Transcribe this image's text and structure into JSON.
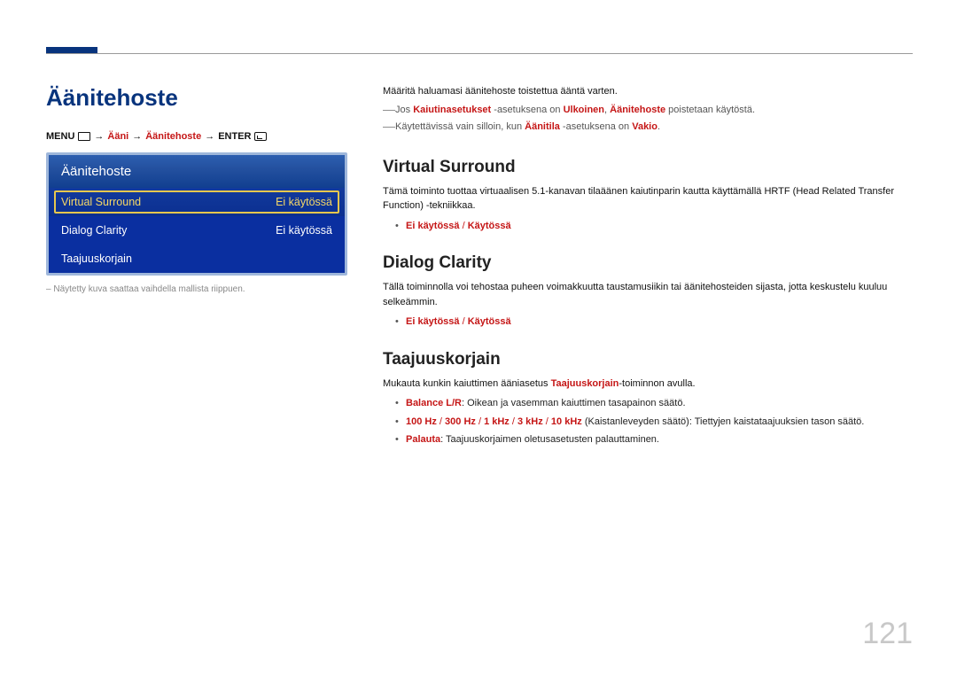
{
  "page_number": "121",
  "title": "Äänitehoste",
  "breadcrumb": {
    "menu": "MENU",
    "arrow": "→",
    "p1": "Ääni",
    "p2": "Äänitehoste",
    "enter": "ENTER"
  },
  "panel": {
    "header": "Äänitehoste",
    "rows": [
      {
        "label": "Virtual Surround",
        "value": "Ei käytössä",
        "selected": true
      },
      {
        "label": "Dialog Clarity",
        "value": "Ei käytössä",
        "selected": false
      },
      {
        "label": "Taajuuskorjain",
        "value": "",
        "selected": false
      }
    ]
  },
  "panel_caption": "Näytetty kuva saattaa vaihdella mallista riippuen.",
  "intro": {
    "line": "Määritä haluamasi äänitehoste toistettua ääntä varten.",
    "note1_pre": "Jos ",
    "note1_b1": "Kaiutinasetukset",
    "note1_mid": " -asetuksena on ",
    "note1_b2": "Ulkoinen",
    "note1_sep": ", ",
    "note1_b3": "Äänitehoste",
    "note1_post": " poistetaan käytöstä.",
    "note2_pre": "Käytettävissä vain silloin, kun ",
    "note2_b1": "Äänitila",
    "note2_mid": " -asetuksena on ",
    "note2_b2": "Vakio",
    "note2_post": "."
  },
  "sections": {
    "virtual": {
      "heading": "Virtual Surround",
      "desc": "Tämä toiminto tuottaa virtuaalisen 5.1-kanavan tilaäänen kaiutinparin kautta käyttämällä HRTF (Head Related Transfer Function) -tekniikkaa.",
      "opt1": "Ei käytössä",
      "opt_sep": " / ",
      "opt2": "Käytössä"
    },
    "dialog": {
      "heading": "Dialog Clarity",
      "desc": "Tällä toiminnolla voi tehostaa puheen voimakkuutta taustamusiikin tai äänitehosteiden sijasta, jotta keskustelu kuuluu selkeämmin.",
      "opt1": "Ei käytössä",
      "opt_sep": " / ",
      "opt2": "Käytössä"
    },
    "eq": {
      "heading": "Taajuuskorjain",
      "desc_pre": "Mukauta kunkin kaiuttimen ääniasetus ",
      "desc_b": "Taajuuskorjain",
      "desc_post": "-toiminnon avulla.",
      "b1_label": "Balance L/R",
      "b1_rest": ": Oikean ja vasemman kaiuttimen tasapainon säätö.",
      "b2_f1": "100 Hz",
      "b2_f2": "300 Hz",
      "b2_f3": "1 kHz",
      "b2_f4": "3 kHz",
      "b2_f5": "10 kHz",
      "b2_rest": " (Kaistanleveyden säätö): Tiettyjen kaistataajuuksien tason säätö.",
      "b3_label": "Palauta",
      "b3_rest": ": Taajuuskorjaimen oletusasetusten palauttaminen."
    }
  }
}
